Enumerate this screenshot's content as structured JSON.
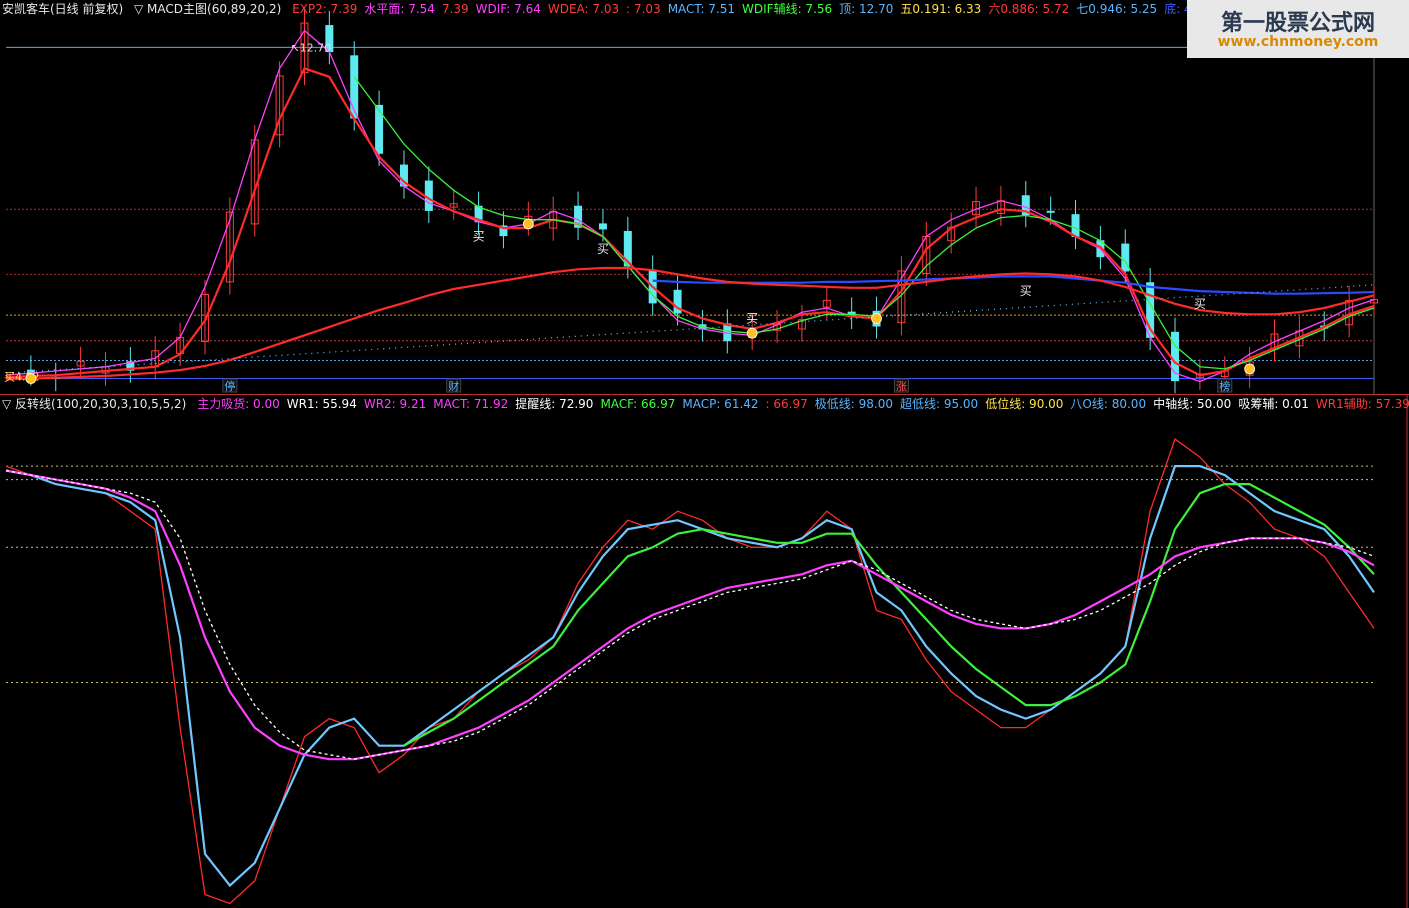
{
  "upper_header": {
    "title": "安凯客车(日线 前复权)",
    "indicator": "▽ MACD主图(60,89,20,2)",
    "values": [
      {
        "label": "EXP2: 7.39",
        "color": "#ff3b3b"
      },
      {
        "label": "水平面: 7.54",
        "color": "#ff40ff"
      },
      {
        "label": "7.39",
        "color": "#ff3b3b"
      },
      {
        "label": "WDIF: 7.64",
        "color": "#ff40ff"
      },
      {
        "label": "WDEA: 7.03",
        "color": "#ff3b3b"
      },
      {
        "label": ": 7.03",
        "color": "#ff3b3b"
      },
      {
        "label": "MACT: 7.51",
        "color": "#5ab4ff"
      },
      {
        "label": "WDIF辅线: 7.56",
        "color": "#40ff40"
      },
      {
        "label": "顶: 12.70",
        "color": "#5ab4ff"
      },
      {
        "label": "五0.191: 6.33",
        "color": "#ffe14a"
      },
      {
        "label": "六0.886: 5.72",
        "color": "#ff3b3b"
      },
      {
        "label": "七0.946: 5.25",
        "color": "#5ab4ff"
      },
      {
        "label": "底: 4.82",
        "color": "#3f5cff"
      }
    ]
  },
  "lower_header": {
    "indicator": "▽ 反转线(100,20,30,3,10,5,5,2)",
    "values": [
      {
        "label": "主力吸货: 0.00",
        "color": "#ff40ff"
      },
      {
        "label": "WR1: 55.94",
        "color": "#ffffff"
      },
      {
        "label": "WR2: 9.21",
        "color": "#ff40ff"
      },
      {
        "label": "MACT: 71.92",
        "color": "#ff40ff"
      },
      {
        "label": "提醒线: 72.90",
        "color": "#ffffff"
      },
      {
        "label": "MACF: 66.97",
        "color": "#40ff40"
      },
      {
        "label": "MACP: 61.42",
        "color": "#5ab4ff"
      },
      {
        "label": ": 66.97",
        "color": "#ff3b3b"
      },
      {
        "label": "极低线: 98.00",
        "color": "#5ab4ff"
      },
      {
        "label": "超低线: 95.00",
        "color": "#5ab4ff"
      },
      {
        "label": "低位线: 90.00",
        "color": "#ffe14a"
      },
      {
        "label": "八O线: 80.00",
        "color": "#5ab4ff"
      },
      {
        "label": "中轴线: 50.00",
        "color": "#ffffff"
      },
      {
        "label": "吸筹辅: 0.01",
        "color": "#ffffff"
      },
      {
        "label": "WR1辅助: 57.39",
        "color": "#ff3b3b"
      }
    ]
  },
  "watermark": {
    "title": "第一股票公式网",
    "url": "www.chnmoney.com"
  },
  "annotations": {
    "top_price": "12.70",
    "bottom_price": "4.82",
    "buy_label": "买",
    "bottom_buy_label": "买4.82"
  },
  "markers": [
    "停",
    "财",
    "涨",
    "榜"
  ],
  "colors": {
    "up": "#ff3b3b",
    "down": "#5ee8f0",
    "red": "#ff2a2a",
    "green": "#3cf03c",
    "magenta": "#ff40ff",
    "blue": "#2a4bff",
    "cyan": "#6fc8ff",
    "orange": "#ffa020",
    "grid": "#2b5cff"
  },
  "chart_data": [
    {
      "type": "line",
      "note_panel": "upper",
      "ylim": [
        4.5,
        13.4
      ],
      "series": [
        {
          "name": "WDIF",
          "color": "#ff40ff",
          "values": [
            4.9,
            4.95,
            5.0,
            5.05,
            5.1,
            5.2,
            5.3,
            5.8,
            7.0,
            8.6,
            10.5,
            12.2,
            13.1,
            12.6,
            11.2,
            10.0,
            9.4,
            9.0,
            8.8,
            8.55,
            8.4,
            8.5,
            8.8,
            8.6,
            8.2,
            7.5,
            6.8,
            6.2,
            6.0,
            5.9,
            5.85,
            6.1,
            6.4,
            6.5,
            6.3,
            6.25,
            7.2,
            8.2,
            8.6,
            8.85,
            9.05,
            8.9,
            8.6,
            8.2,
            7.9,
            7.2,
            5.8,
            4.95,
            4.75,
            5.0,
            5.4,
            5.7,
            5.95,
            6.2,
            6.5,
            6.7
          ]
        },
        {
          "name": "EXP2",
          "color": "#ff2a2a",
          "values": [
            4.85,
            4.88,
            4.9,
            4.95,
            5.0,
            5.05,
            5.1,
            5.4,
            6.2,
            7.6,
            9.3,
            11.0,
            12.2,
            12.0,
            11.0,
            10.1,
            9.5,
            9.1,
            8.8,
            8.6,
            8.4,
            8.4,
            8.6,
            8.5,
            8.2,
            7.6,
            7.0,
            6.5,
            6.25,
            6.1,
            6.0,
            6.15,
            6.35,
            6.4,
            6.3,
            6.25,
            6.9,
            7.9,
            8.4,
            8.65,
            8.85,
            8.8,
            8.55,
            8.2,
            7.95,
            7.3,
            6.0,
            5.2,
            4.9,
            5.0,
            5.3,
            5.55,
            5.8,
            6.05,
            6.35,
            6.55
          ]
        },
        {
          "name": "WDIF辅线",
          "color": "#3cf03c",
          "values": [
            null,
            null,
            null,
            null,
            null,
            null,
            null,
            null,
            null,
            null,
            null,
            null,
            null,
            null,
            12.0,
            11.2,
            10.4,
            9.8,
            9.3,
            8.9,
            8.7,
            8.6,
            8.6,
            8.5,
            8.2,
            7.5,
            6.8,
            6.3,
            6.05,
            5.95,
            5.9,
            6.0,
            6.2,
            6.35,
            6.35,
            6.3,
            6.8,
            7.5,
            8.0,
            8.4,
            8.65,
            8.7,
            8.6,
            8.4,
            8.1,
            7.6,
            6.6,
            5.6,
            5.1,
            5.05,
            5.25,
            5.5,
            5.75,
            6.0,
            6.3,
            6.5
          ]
        },
        {
          "name": "MACT",
          "color": "#2a4bff",
          "values": [
            null,
            null,
            null,
            null,
            null,
            null,
            null,
            null,
            null,
            null,
            null,
            null,
            null,
            null,
            null,
            null,
            null,
            null,
            null,
            null,
            null,
            null,
            null,
            null,
            null,
            null,
            7.15,
            7.12,
            7.1,
            7.1,
            7.1,
            7.1,
            7.1,
            7.12,
            7.12,
            7.14,
            7.15,
            7.18,
            7.2,
            7.22,
            7.25,
            7.25,
            7.25,
            7.2,
            7.15,
            7.1,
            7.0,
            6.95,
            6.9,
            6.88,
            6.86,
            6.84,
            6.84,
            6.85,
            6.86,
            6.88
          ]
        },
        {
          "name": "WDEA",
          "color": "#ff2a2a",
          "values": [
            4.8,
            4.82,
            4.84,
            4.86,
            4.88,
            4.92,
            4.96,
            5.02,
            5.12,
            5.26,
            5.45,
            5.65,
            5.85,
            6.05,
            6.25,
            6.45,
            6.62,
            6.8,
            6.95,
            7.05,
            7.15,
            7.25,
            7.35,
            7.42,
            7.45,
            7.45,
            7.4,
            7.3,
            7.2,
            7.12,
            7.08,
            7.05,
            7.03,
            7.0,
            6.98,
            6.98,
            7.05,
            7.12,
            7.2,
            7.25,
            7.3,
            7.32,
            7.3,
            7.25,
            7.15,
            7.0,
            6.8,
            6.6,
            6.45,
            6.38,
            6.35,
            6.35,
            6.4,
            6.5,
            6.65,
            6.8
          ]
        }
      ]
    },
    {
      "type": "line",
      "note_panel": "lower",
      "ylim": [
        0,
        110
      ],
      "series": [
        {
          "name": "WR2",
          "color": "#ff2a2a",
          "values": [
            98,
            96,
            94,
            93,
            92,
            88,
            84,
            40,
            3,
            1,
            6,
            22,
            38,
            42,
            40,
            30,
            34,
            40,
            42,
            48,
            52,
            55,
            60,
            72,
            80,
            86,
            84,
            88,
            86,
            82,
            80,
            80,
            82,
            88,
            84,
            66,
            64,
            55,
            48,
            44,
            40,
            40,
            44,
            48,
            52,
            58,
            88,
            104,
            100,
            94,
            90,
            84,
            82,
            78,
            70,
            62
          ]
        },
        {
          "name": "WR1",
          "color": "#6fc8ff",
          "values": [
            97,
            96,
            94,
            93,
            92,
            90,
            86,
            60,
            12,
            5,
            10,
            22,
            34,
            40,
            42,
            36,
            36,
            40,
            44,
            48,
            52,
            56,
            60,
            70,
            78,
            84,
            85,
            86,
            84,
            82,
            81,
            80,
            82,
            86,
            84,
            70,
            66,
            58,
            52,
            47,
            44,
            42,
            44,
            48,
            52,
            58,
            82,
            98,
            98,
            96,
            92,
            88,
            86,
            84,
            78,
            70
          ]
        },
        {
          "name": "MACF",
          "color": "#3cf03c",
          "values": [
            null,
            null,
            null,
            null,
            null,
            null,
            null,
            null,
            null,
            null,
            null,
            null,
            null,
            null,
            null,
            null,
            36,
            39,
            42,
            46,
            50,
            54,
            58,
            66,
            72,
            78,
            80,
            83,
            84,
            83,
            82,
            81,
            81,
            83,
            83,
            76,
            70,
            64,
            58,
            53,
            49,
            45,
            45,
            47,
            50,
            54,
            68,
            84,
            92,
            94,
            94,
            91,
            88,
            85,
            80,
            74
          ]
        },
        {
          "name": "MACT",
          "color": "#ff40ff",
          "values": [
            97,
            96,
            95,
            94,
            93,
            91,
            88,
            76,
            60,
            48,
            40,
            36,
            34,
            33,
            33,
            34,
            35,
            36,
            38,
            40,
            43,
            46,
            50,
            54,
            58,
            62,
            65,
            67,
            69,
            71,
            72,
            73,
            74,
            76,
            77,
            74,
            71,
            68,
            65,
            63,
            62,
            62,
            63,
            65,
            68,
            71,
            74,
            78,
            80,
            81,
            82,
            82,
            82,
            81,
            79,
            76
          ]
        },
        {
          "name": "提醒线",
          "color": "#ffffff",
          "values": [
            97,
            96,
            95,
            94,
            93,
            92,
            90,
            82,
            66,
            54,
            45,
            39,
            35,
            34,
            33,
            34,
            35,
            36,
            37,
            39,
            42,
            45,
            49,
            53,
            57,
            61,
            64,
            66,
            68,
            70,
            71,
            72,
            73,
            75,
            77,
            75,
            72,
            69,
            66,
            64,
            63,
            62,
            63,
            64,
            66,
            69,
            72,
            76,
            79,
            81,
            82,
            82,
            82,
            81,
            80,
            78
          ]
        },
        {
          "name": "主力吸货",
          "type": "bar",
          "color": "#ffa020",
          "values": [
            0,
            0,
            0,
            0,
            0,
            0,
            0,
            0,
            0,
            0,
            0,
            0,
            0,
            0,
            0,
            0,
            0,
            0,
            0,
            0,
            0,
            0,
            0,
            0,
            0,
            0,
            0,
            0,
            0,
            0,
            0,
            0,
            0,
            0,
            0,
            0,
            0,
            0,
            0,
            0,
            0,
            0,
            0,
            0,
            0,
            0,
            0,
            0,
            0,
            0,
            0,
            0,
            0,
            0,
            0,
            0
          ]
        },
        {
          "name": "吸筹辅",
          "type": "bar",
          "color": "#ffa020",
          "values": [
            0,
            0,
            0,
            0,
            0,
            0,
            0,
            0,
            0,
            0,
            0,
            0,
            0,
            0,
            0,
            0,
            0,
            0,
            0,
            0,
            0,
            0,
            0,
            0,
            0,
            0,
            0,
            0,
            0,
            0,
            0,
            0,
            0,
            0,
            0,
            0,
            0,
            0,
            0,
            0,
            0,
            0,
            0,
            0,
            0,
            0,
            0,
            0,
            0,
            0,
            0,
            0,
            0,
            0,
            0,
            0
          ]
        }
      ]
    }
  ]
}
